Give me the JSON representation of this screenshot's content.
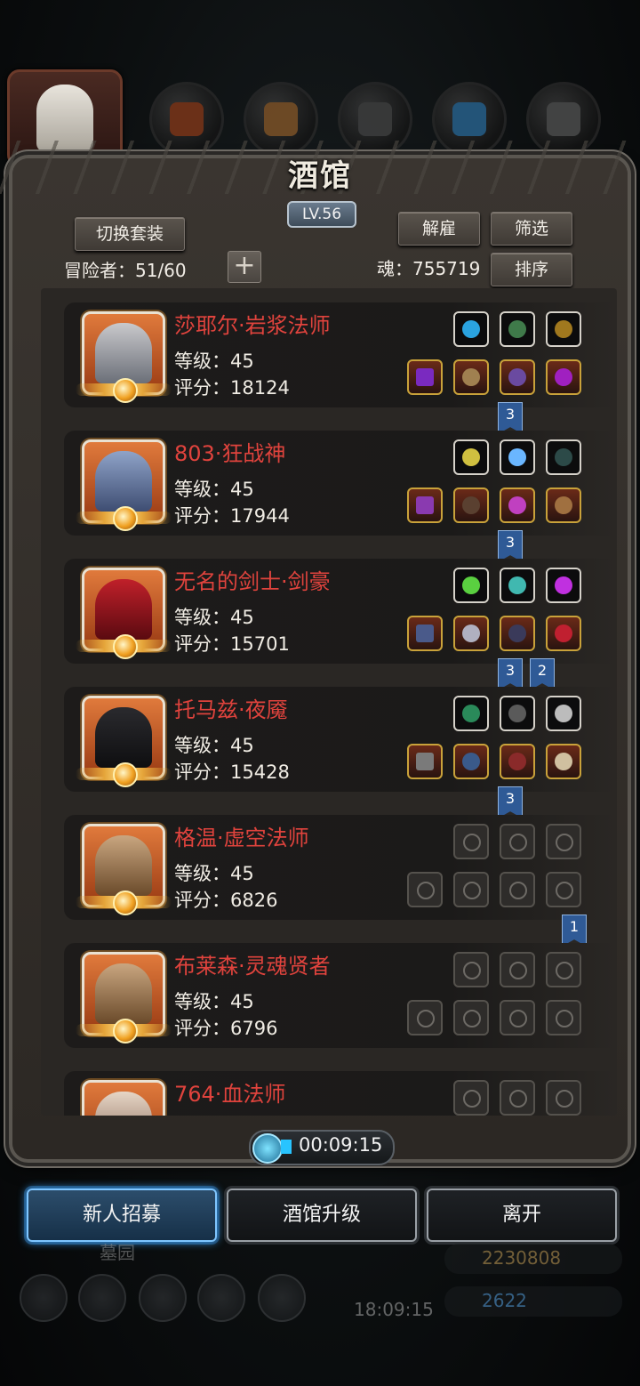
{
  "dialog": {
    "title": "酒馆",
    "level": "LV.56"
  },
  "toolbar": {
    "switch_outfit": "切换套装",
    "dismiss": "解雇",
    "filter": "筛选",
    "sort": "排序",
    "adventurers": "冒险者：51/60",
    "soul": "魂：755719",
    "add_icon": "plus-icon"
  },
  "heroes": [
    {
      "name": "莎耶尔·岩浆法师",
      "level": "等级：45",
      "score": "评分：18124",
      "ribbons": [
        "3"
      ]
    },
    {
      "name": "803·狂战神",
      "level": "等级：45",
      "score": "评分：17944",
      "ribbons": [
        "3"
      ]
    },
    {
      "name": "无名的剑士·剑豪",
      "level": "等级：45",
      "score": "评分：15701",
      "ribbons": [
        "3",
        "2"
      ]
    },
    {
      "name": "托马兹·夜魇",
      "level": "等级：45",
      "score": "评分：15428",
      "ribbons": [
        "3"
      ]
    },
    {
      "name": "格温·虚空法师",
      "level": "等级：45",
      "score": "评分：6826",
      "ribbons": [
        "1"
      ]
    },
    {
      "name": "布莱森·灵魂贤者",
      "level": "等级：45",
      "score": "评分：6796",
      "ribbons": []
    },
    {
      "name": "764·血法师",
      "level": "",
      "score": "",
      "ribbons": []
    }
  ],
  "timer": "00:09:15",
  "actions": {
    "recruit": "新人招募",
    "upgrade": "酒馆升级",
    "leave": "离开"
  },
  "background_hud": {
    "gold": "2230808",
    "gems": "2622",
    "clock": "18:09:15",
    "garden": "墓园"
  },
  "colors": {
    "hero_name": "#e0433d",
    "accent_blue": "#3aa6ff",
    "ribbon": "#2f5a96"
  }
}
